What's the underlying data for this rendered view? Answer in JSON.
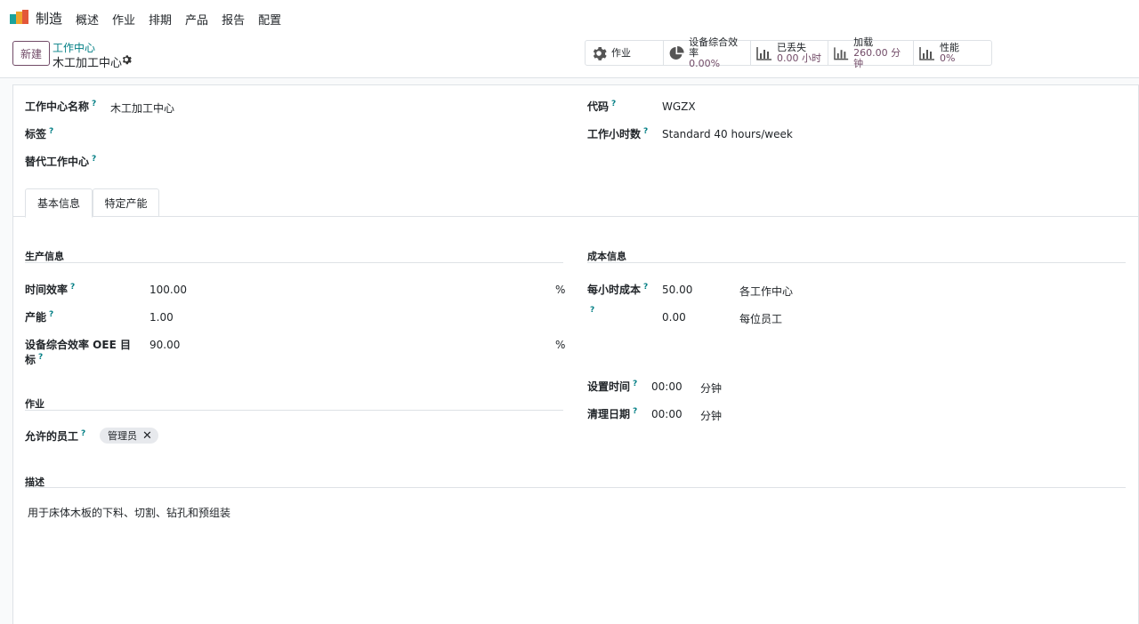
{
  "app": {
    "name": "制造"
  },
  "menu": [
    "概述",
    "作业",
    "排期",
    "产品",
    "报告",
    "配置"
  ],
  "control_panel": {
    "new_label": "新建",
    "breadcrumb_parent": "工作中心",
    "breadcrumb_current": "木工加工中心"
  },
  "stats": [
    {
      "label": "作业",
      "value": "",
      "icon": "gear-icon"
    },
    {
      "label": "设备综合效率",
      "value": "0.00%",
      "icon": "pie-chart-icon"
    },
    {
      "label": "已丢失",
      "value": "0.00 小时",
      "icon": "bar-chart-icon"
    },
    {
      "label": "加载",
      "value": "260.00 分钟",
      "icon": "bar-chart-icon"
    },
    {
      "label": "性能",
      "value": "0%",
      "icon": "bar-chart-icon"
    }
  ],
  "form": {
    "name_label": "工作中心名称",
    "name_value": "木工加工中心",
    "tags_label": "标签",
    "alt_label": "替代工作中心",
    "code_label": "代码",
    "code_value": "WGZX",
    "hours_label": "工作小时数",
    "hours_value": "Standard 40 hours/week"
  },
  "tabs": [
    "基本信息",
    "特定产能"
  ],
  "production": {
    "title": "生产信息",
    "time_eff_label": "时间效率",
    "time_eff_value": "100.00",
    "time_eff_unit": "%",
    "capacity_label": "产能",
    "capacity_value": "1.00",
    "oee_label_1": "设备综合效率 OEE 目",
    "oee_label_2": "标",
    "oee_value": "90.00",
    "oee_unit": "%"
  },
  "cost": {
    "title": "成本信息",
    "hourly_label": "每小时成本",
    "hourly_value": "50.00",
    "hourly_unit": "各工作中心",
    "employee_value": "0.00",
    "employee_unit": "每位员工",
    "setup_label": "设置时间",
    "setup_value": "00:00",
    "setup_unit": "分钟",
    "cleanup_label": "清理日期",
    "cleanup_value": "00:00",
    "cleanup_unit": "分钟"
  },
  "operations": {
    "title": "作业",
    "employees_label": "允许的员工",
    "employee_tag": "管理员"
  },
  "description": {
    "title": "描述",
    "text": "用于床体木板的下料、切割、钻孔和预组装"
  },
  "help_mark": "?",
  "colors": {
    "brand": "#714b67",
    "link": "#017e84"
  }
}
